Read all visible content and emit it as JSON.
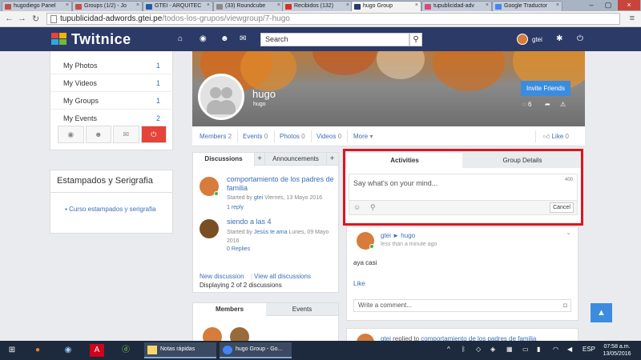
{
  "browser": {
    "tabs": [
      {
        "label": "hugodiego Panel",
        "color": "#c0504d"
      },
      {
        "label": "Groups (1/2) - Jo",
        "color": "#c0504d"
      },
      {
        "label": "GTEI - ARQUITEC",
        "color": "#2b5aa6"
      },
      {
        "label": "(33) Roundcube",
        "color": "#8a8a8a"
      },
      {
        "label": "Recibidos (132)",
        "color": "#d93025"
      },
      {
        "label": "hugo Group",
        "color": "#2b3a67"
      },
      {
        "label": "tupublicidad-adv",
        "color": "#d84a7a"
      },
      {
        "label": "Google Traductor",
        "color": "#4285f4"
      }
    ],
    "url_host": "tupublicidad-adwords.gtei.pe",
    "url_path": "/todos-los-grupos/viewgroup/7-hugo"
  },
  "site": {
    "brand": "Twitnice",
    "search_placeholder": "Search",
    "username": "gtei",
    "colors": {
      "nav": "#2b3a67",
      "accent": "#3b8cde",
      "link": "#3b6fb6",
      "danger": "#e4443a"
    }
  },
  "sidebar": {
    "items": [
      {
        "label": "My Photos",
        "count": "1"
      },
      {
        "label": "My Videos",
        "count": "1"
      },
      {
        "label": "My Groups",
        "count": "1"
      },
      {
        "label": "My Events",
        "count": "2"
      }
    ],
    "icons": [
      "globe-icon",
      "user-icon",
      "mail-icon",
      "power-icon"
    ],
    "section_title": "Estampados y Serigrafia",
    "section_link": "Curso estampados y serigrafia"
  },
  "group": {
    "name": "hugo",
    "subtitle": "hugo",
    "invite_label": "Invite Friends",
    "comments_count": "6",
    "stats": {
      "members_label": "Members",
      "members_count": "2",
      "events_label": "Events",
      "events_count": "0",
      "photos_label": "Photos",
      "photos_count": "0",
      "videos_label": "Videos",
      "videos_count": "0",
      "more_label": "More",
      "like_label": "Like",
      "like_count": "0"
    }
  },
  "discussions": {
    "tab_active": "Discussions",
    "tab_other": "Announcements",
    "items": [
      {
        "title": "comportamiento de los padres de familia",
        "meta_prefix": "Started by",
        "author": "gtei",
        "date": "Viernes, 13 Mayo 2016",
        "replies": "1 reply"
      },
      {
        "title": "siendo a las 4",
        "meta_prefix": "Started by",
        "author": "Jesús te ama",
        "date": "Lunes, 09 Mayo 2016",
        "replies": "0 Replies"
      }
    ],
    "new_link": "New discussion",
    "view_all_link": "View all discussions",
    "summary": "Displaying 2 of 2 discussions"
  },
  "members_box": {
    "tab_active": "Members",
    "tab_other": "Events"
  },
  "activity": {
    "tab_active": "Activities",
    "tab_other": "Group Details",
    "placeholder": "Say what's on your mind...",
    "char_count": "400",
    "cancel_label": "Cancel"
  },
  "feed": {
    "post": {
      "author": "gtei",
      "arrow": "►",
      "target": "hugo",
      "time": "less than a minute ago",
      "body": "aya casi",
      "like_label": "Like",
      "comment_placeholder": "Write a comment..."
    },
    "next_post": {
      "author": "gtei",
      "action": "replied to",
      "target": "comportamiento de los padres de familia"
    }
  },
  "taskbar": {
    "apps": [
      {
        "label": "Notas rápidas",
        "color": "#f5d76e"
      },
      {
        "label": "hugo Group - Go...",
        "color": "#4285f4"
      }
    ],
    "language": "ESP",
    "time": "07:58 a.m.",
    "date": "13/05/2016"
  }
}
